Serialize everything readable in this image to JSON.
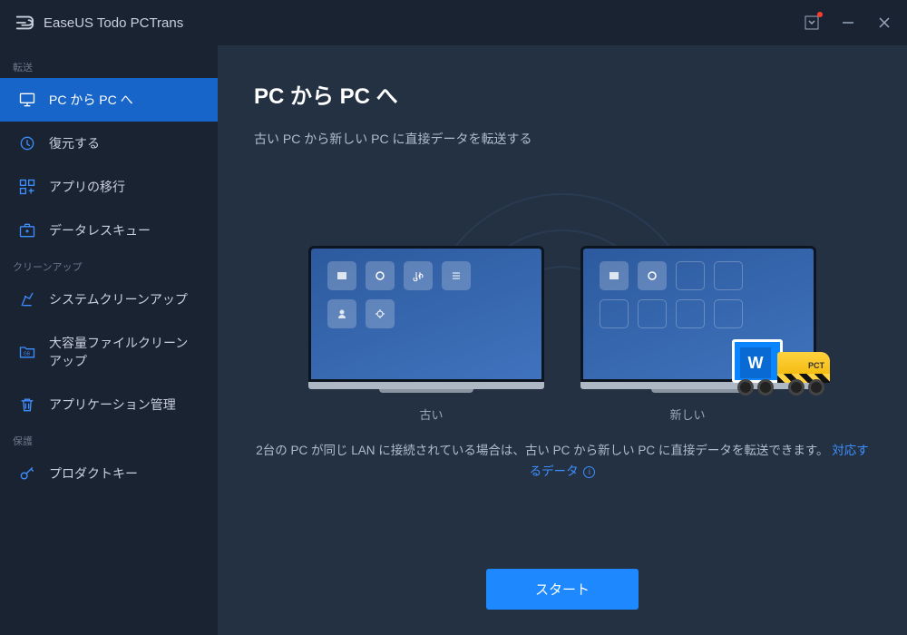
{
  "titlebar": {
    "app_name": "EaseUS Todo PCTrans"
  },
  "sidebar": {
    "section_transfer": "転送",
    "section_cleanup": "クリーンアップ",
    "section_protect": "保護",
    "items": {
      "pc_to_pc": "PC から PC へ",
      "restore": "復元する",
      "app_migration": "アプリの移行",
      "data_rescue": "データレスキュー",
      "system_cleanup": "システムクリーンアップ",
      "large_file_cleanup": "大容量ファイルクリーンアップ",
      "app_management": "アプリケーション管理",
      "product_key": "プロダクトキー"
    }
  },
  "content": {
    "heading": "PC から PC へ",
    "subtitle": "古い PC から新しい PC に直接データを転送する",
    "label_old": "古い",
    "label_new": "新しい",
    "description_1": "2台の PC が同じ LAN に接続されている場合は、古い PC から新しい PC に直接データを転送できます。",
    "link_text": "対応するデータ",
    "start_button": "スタート",
    "truck_label": "PCT"
  }
}
